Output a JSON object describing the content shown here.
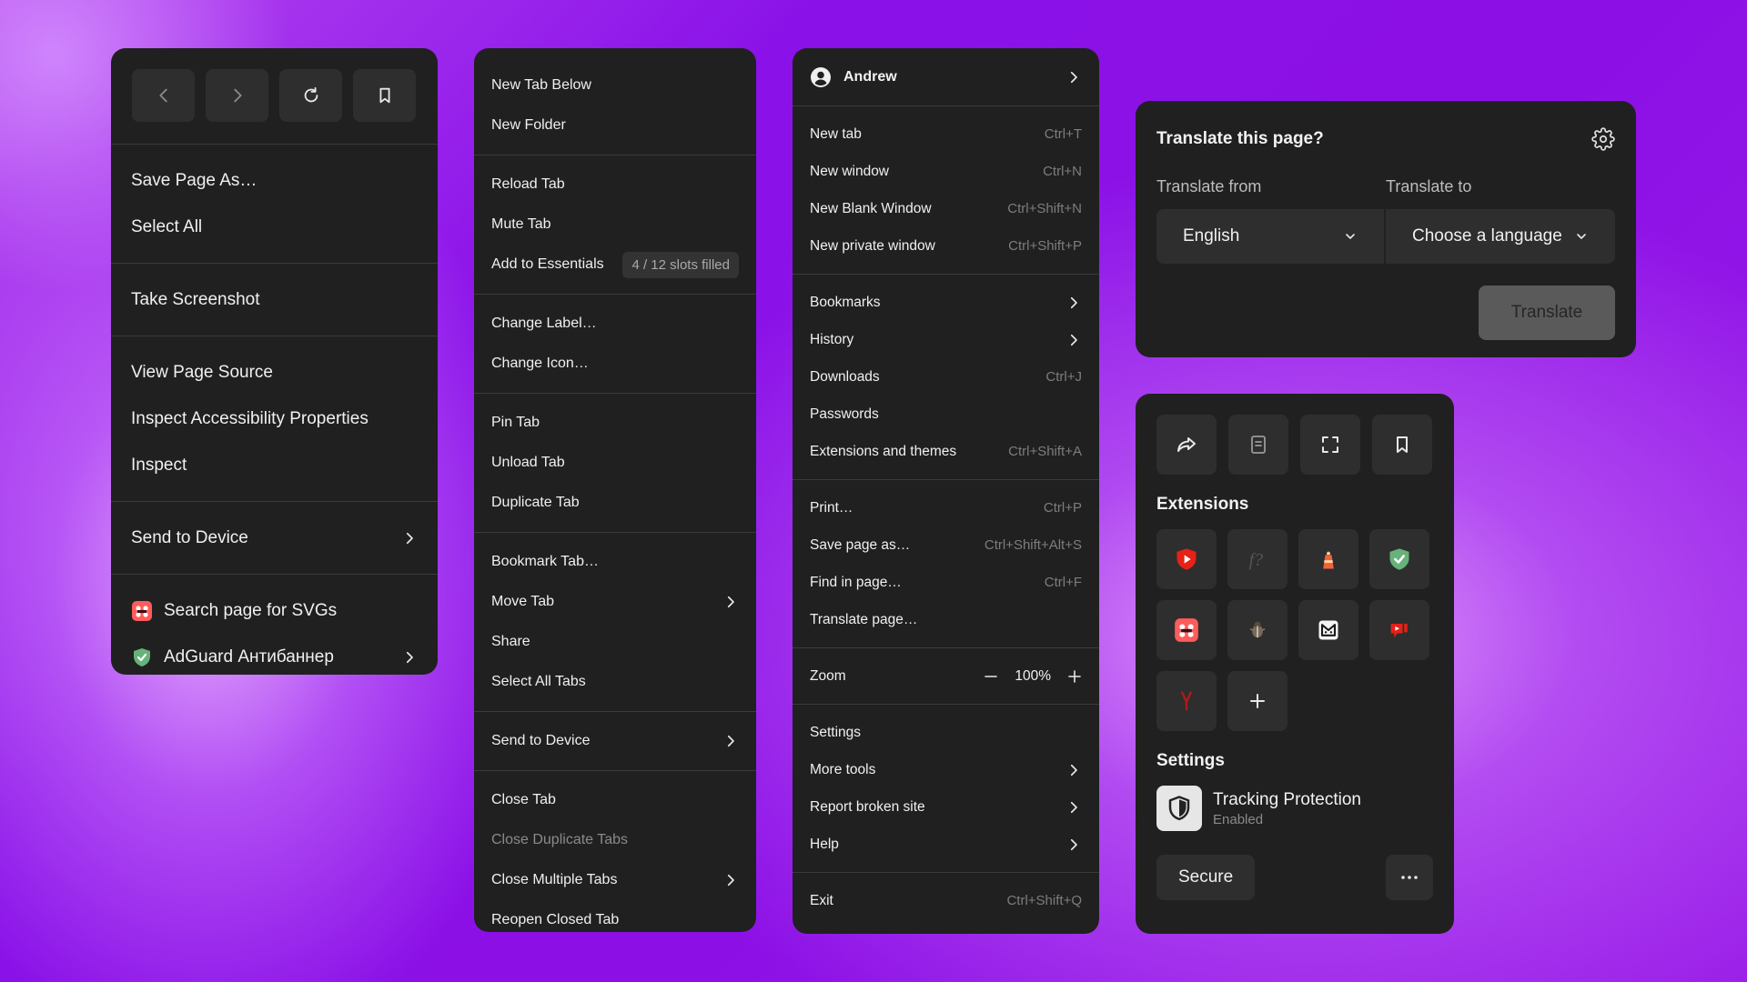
{
  "colors": {
    "panel_bg": "#202020",
    "tile_bg": "#2e2e2e",
    "separator": "#3a3a3a",
    "accent_purple": "#8c10e6"
  },
  "page_menu": {
    "nav_icons": [
      "back-icon",
      "forward-icon",
      "reload-icon",
      "bookmark-icon"
    ],
    "save_page_as": "Save Page As…",
    "select_all": "Select All",
    "take_screenshot": "Take Screenshot",
    "view_page_source": "View Page Source",
    "inspect_accessibility": "Inspect Accessibility Properties",
    "inspect": "Inspect",
    "send_to_device": "Send to Device",
    "search_svgs": "Search page for SVGs",
    "adguard": "AdGuard Антибаннер"
  },
  "tab_menu": {
    "new_tab_below": "New Tab Below",
    "new_folder": "New Folder",
    "reload_tab": "Reload Tab",
    "mute_tab": "Mute Tab",
    "add_to_essentials": "Add to Essentials",
    "essentials_badge": "4 / 12 slots filled",
    "change_label": "Change Label…",
    "change_icon": "Change Icon…",
    "pin_tab": "Pin Tab",
    "unload_tab": "Unload Tab",
    "duplicate_tab": "Duplicate Tab",
    "bookmark_tab": "Bookmark Tab…",
    "move_tab": "Move Tab",
    "share": "Share",
    "select_all_tabs": "Select All Tabs",
    "send_to_device": "Send to Device",
    "close_tab": "Close Tab",
    "close_duplicate_tabs": "Close Duplicate Tabs",
    "close_multiple_tabs": "Close Multiple Tabs",
    "reopen_closed_tab": "Reopen Closed Tab"
  },
  "app_menu": {
    "profile_name": "Andrew",
    "new_tab": {
      "label": "New tab",
      "shortcut": "Ctrl+T"
    },
    "new_window": {
      "label": "New window",
      "shortcut": "Ctrl+N"
    },
    "new_blank_window": {
      "label": "New Blank Window",
      "shortcut": "Ctrl+Shift+N"
    },
    "new_private_window": {
      "label": "New private window",
      "shortcut": "Ctrl+Shift+P"
    },
    "bookmarks": "Bookmarks",
    "history": "History",
    "downloads": {
      "label": "Downloads",
      "shortcut": "Ctrl+J"
    },
    "passwords": "Passwords",
    "extensions_themes": {
      "label": "Extensions and themes",
      "shortcut": "Ctrl+Shift+A"
    },
    "print": {
      "label": "Print…",
      "shortcut": "Ctrl+P"
    },
    "save_page_as": {
      "label": "Save page as…",
      "shortcut": "Ctrl+Shift+Alt+S"
    },
    "find_in_page": {
      "label": "Find in page…",
      "shortcut": "Ctrl+F"
    },
    "translate_page": "Translate page…",
    "zoom": {
      "label": "Zoom",
      "value": "100%"
    },
    "settings": "Settings",
    "more_tools": "More tools",
    "report_broken_site": "Report broken site",
    "help": "Help",
    "exit": {
      "label": "Exit",
      "shortcut": "Ctrl+Shift+Q"
    }
  },
  "translate": {
    "title": "Translate this page?",
    "from_label": "Translate from",
    "to_label": "Translate to",
    "from_value": "English",
    "to_value": "Choose a language",
    "button": "Translate"
  },
  "site_panel": {
    "action_icons": [
      "share-icon",
      "reader-icon",
      "screenshot-icon",
      "bookmark-icon"
    ],
    "extensions_title": "Extensions",
    "extension_icons": [
      "youtube-shield-icon",
      "font-finder-icon",
      "lighthouse-icon",
      "adguard-icon",
      "svg-search-icon",
      "bug-icon",
      "metamask-icon",
      "youtube-dislike-icon",
      "yandex-icon",
      "add-extension-icon"
    ],
    "settings_title": "Settings",
    "tracking_title": "Tracking Protection",
    "tracking_status": "Enabled",
    "secure_label": "Secure"
  }
}
